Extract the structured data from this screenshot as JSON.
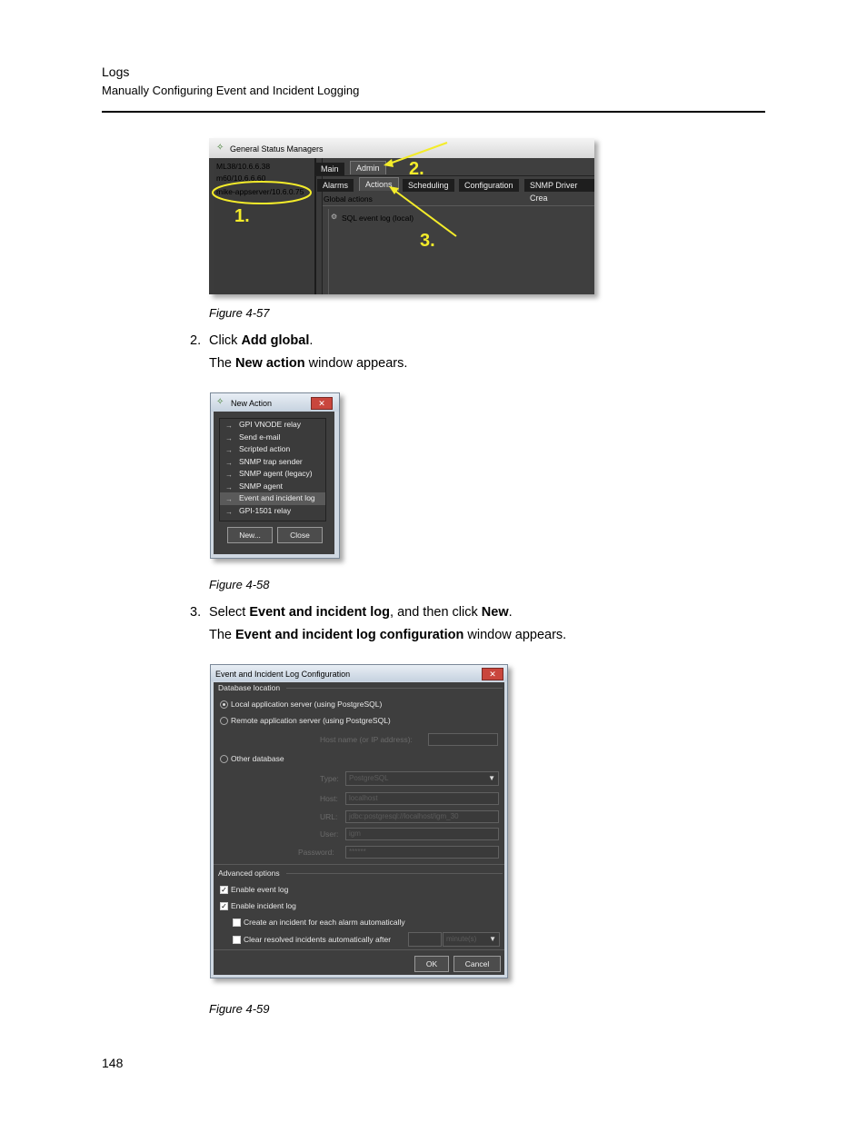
{
  "header": {
    "section": "Logs",
    "subsection": "Manually Configuring Event and Incident Logging"
  },
  "fig57": {
    "window_title": "General Status Managers",
    "managers": [
      "ML38/10.6.6.38",
      "m60/10.6.6.60",
      "mike-appserver/10.6.0.75"
    ],
    "top_tabs": [
      "Main",
      "Admin"
    ],
    "sub_tabs": [
      "Alarms",
      "Actions",
      "Scheduling",
      "Configuration",
      "SNMP Driver Crea"
    ],
    "group_label": "Global actions",
    "list_item": "SQL event log (local)",
    "annotations": [
      "1.",
      "2.",
      "3."
    ],
    "caption": "Figure 4-57"
  },
  "step2": {
    "number": "2.",
    "text_pre": "Click ",
    "bold": "Add global",
    "text_post": "."
  },
  "step2_result": {
    "text_pre": "The ",
    "bold": "New action",
    "text_post": " window appears."
  },
  "fig58": {
    "window_title": "New Action",
    "items": [
      "GPI VNODE relay",
      "Send e-mail",
      "Scripted action",
      "SNMP trap sender",
      "SNMP agent (legacy)",
      "SNMP agent",
      "Event and incident log",
      "GPI-1501 relay"
    ],
    "new_label": "New...",
    "close_label": "Close",
    "caption": "Figure 4-58"
  },
  "step3": {
    "number": "3.",
    "text_pre": "Select ",
    "bold1": "Event and incident log",
    "text_mid": ", and then click ",
    "bold2": "New",
    "text_post": "."
  },
  "step3_result": {
    "text_pre": "The ",
    "bold": "Event and incident log configuration",
    "text_post": " window appears."
  },
  "fig59": {
    "window_title": "Event and Incident Log Configuration",
    "db_group": "Database location",
    "opt_local": "Local application server (using PostgreSQL)",
    "opt_remote": "Remote application server (using PostgreSQL)",
    "host_label": "Host name (or IP address):",
    "opt_other": "Other database",
    "type_label": "Type:",
    "type_value": "PostgreSQL",
    "host2_label": "Host:",
    "host2_value": "localhost",
    "url_label": "URL:",
    "url_value": "jdbc:postgresql://localhost/igm_30",
    "user_label": "User:",
    "user_value": "igm",
    "password_label": "Password:",
    "password_value": "******",
    "adv_group": "Advanced options",
    "enable_event": "Enable event log",
    "enable_incident": "Enable incident log",
    "create_incident": "Create an incident for each alarm automatically",
    "clear_resolved": "Clear resolved incidents automatically after",
    "minutes_value": "minute(s)",
    "ok_label": "OK",
    "cancel_label": "Cancel",
    "caption": "Figure 4-59"
  },
  "page_number": "148"
}
